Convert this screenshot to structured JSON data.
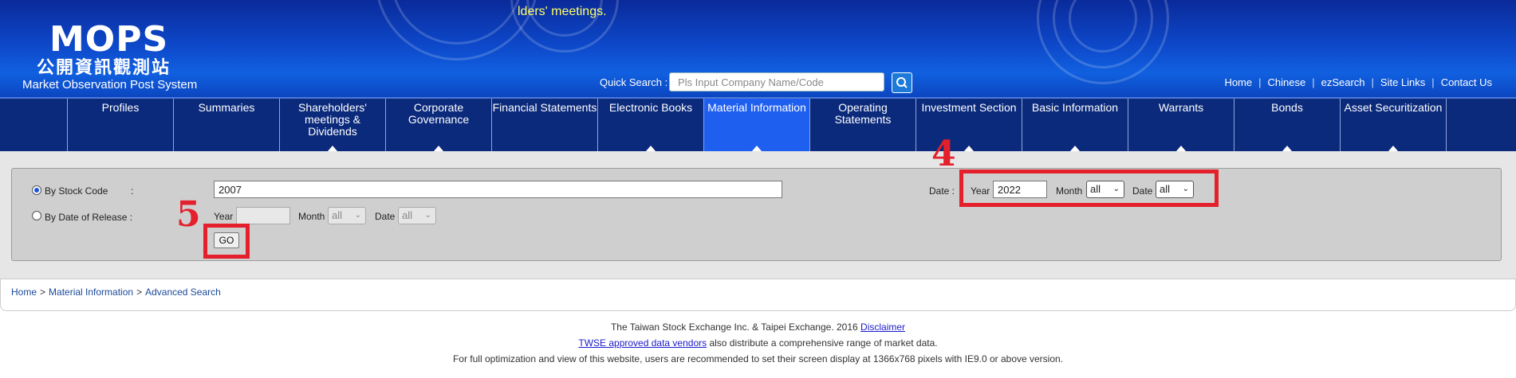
{
  "header": {
    "logo_main": "MOPS",
    "logo_cn": "公開資訊觀測站",
    "logo_en": "Market Observation Post System",
    "marquee": "lders' meetings.",
    "quick_search_label": "Quick Search :",
    "quick_search_placeholder": "Pls Input Company Name/Code",
    "quick_search_icon": "search-icon",
    "top_links": [
      "Home",
      "Chinese",
      "ezSearch",
      "Site Links",
      "Contact Us"
    ]
  },
  "nav": {
    "items": [
      {
        "label": "Profiles",
        "has_arrow": false,
        "active": false
      },
      {
        "label": "Summaries",
        "has_arrow": false,
        "active": false
      },
      {
        "label": "Shareholders' meetings & Dividends",
        "has_arrow": true,
        "active": false
      },
      {
        "label": "Corporate Governance",
        "has_arrow": true,
        "active": false
      },
      {
        "label": "Financial Statements",
        "has_arrow": false,
        "active": false
      },
      {
        "label": "Electronic Books",
        "has_arrow": true,
        "active": false
      },
      {
        "label": "Material Information",
        "has_arrow": true,
        "active": true
      },
      {
        "label": "Operating Statements",
        "has_arrow": false,
        "active": false
      },
      {
        "label": "Investment Section",
        "has_arrow": true,
        "active": false
      },
      {
        "label": "Basic Information",
        "has_arrow": true,
        "active": false
      },
      {
        "label": "Warrants",
        "has_arrow": true,
        "active": false
      },
      {
        "label": "Bonds",
        "has_arrow": true,
        "active": false
      },
      {
        "label": "Asset Securitization",
        "has_arrow": true,
        "active": false
      }
    ]
  },
  "search": {
    "by_stock_code_label": "By Stock Code",
    "colon": ":",
    "stock_code_value": "2007",
    "by_date_label": "By Date of Release :",
    "year_label": "Year",
    "month_label": "Month",
    "date_label": "Date",
    "month_value": "all",
    "date_value": "all",
    "date_prefix": "Date :",
    "year_value": "2022",
    "month_value_2": "all",
    "date_value_2": "all",
    "go_label": "GO"
  },
  "annotations": {
    "four": "4",
    "five": "5"
  },
  "breadcrumb": [
    "Home",
    "Material Information",
    "Advanced Search"
  ],
  "footer": {
    "line1_text": "The Taiwan Stock Exchange Inc. & Taipei Exchange. 2016 ",
    "line1_link": "Disclaimer",
    "line2_link": "TWSE approved data vendors",
    "line2_text": " also distribute a comprehensive range of market data.",
    "line3_text": "For full optimization and view of this website, users are recommended to set their screen display at 1366x768 pixels with IE9.0 or above version."
  },
  "colors": {
    "header_blue": "#0d47c8",
    "nav_blue": "#0b2a7c",
    "active_blue": "#1f5ff0",
    "annotation_red": "#e3202b",
    "marquee_yellow": "#ffff66"
  }
}
